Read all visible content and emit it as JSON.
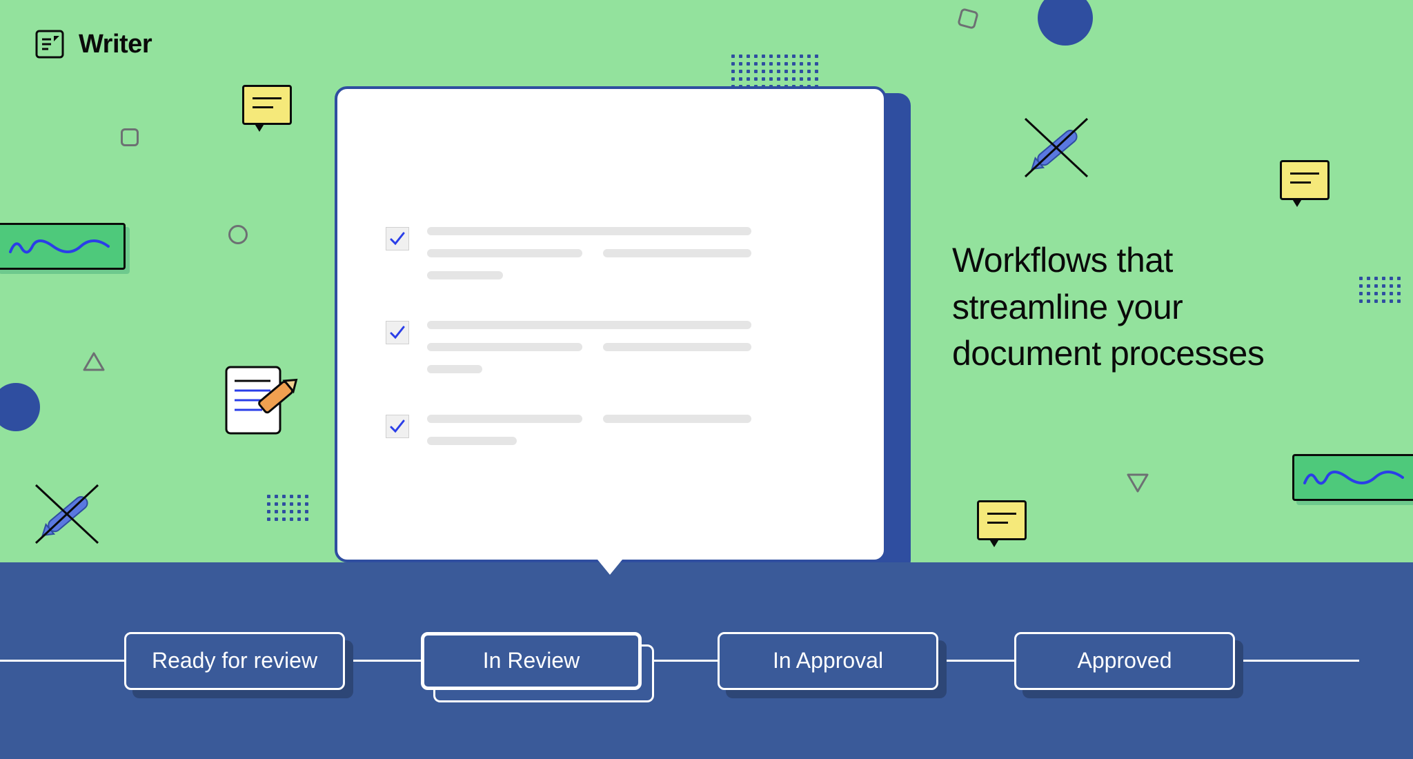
{
  "brand": {
    "name": "Writer"
  },
  "headline": "Workflows that streamline your document processes",
  "workflow": {
    "stages": [
      {
        "label": "Ready for review",
        "active": false
      },
      {
        "label": "In Review",
        "active": true
      },
      {
        "label": "In Approval",
        "active": false
      },
      {
        "label": "Approved",
        "active": false
      }
    ]
  }
}
